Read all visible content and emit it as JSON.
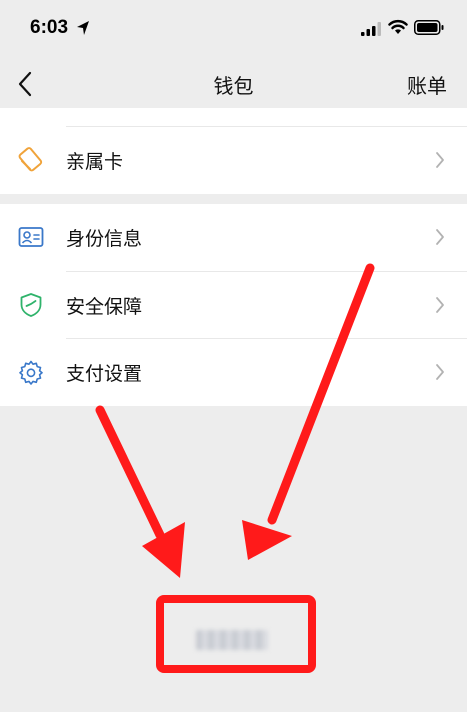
{
  "status": {
    "time": "6:03"
  },
  "nav": {
    "title": "钱包",
    "right_label": "账单"
  },
  "groups": [
    {
      "items": [
        {
          "label": "亲属卡",
          "icon": "family-card-icon"
        }
      ]
    },
    {
      "items": [
        {
          "label": "身份信息",
          "icon": "id-card-icon"
        },
        {
          "label": "安全保障",
          "icon": "shield-icon"
        },
        {
          "label": "支付设置",
          "icon": "gear-icon"
        }
      ]
    }
  ],
  "colors": {
    "background": "#ededed",
    "annotation_red": "#ff1a1a",
    "family_card_orange": "#f0a33a",
    "id_blue": "#3a78c9",
    "shield_green": "#2fb36b"
  }
}
